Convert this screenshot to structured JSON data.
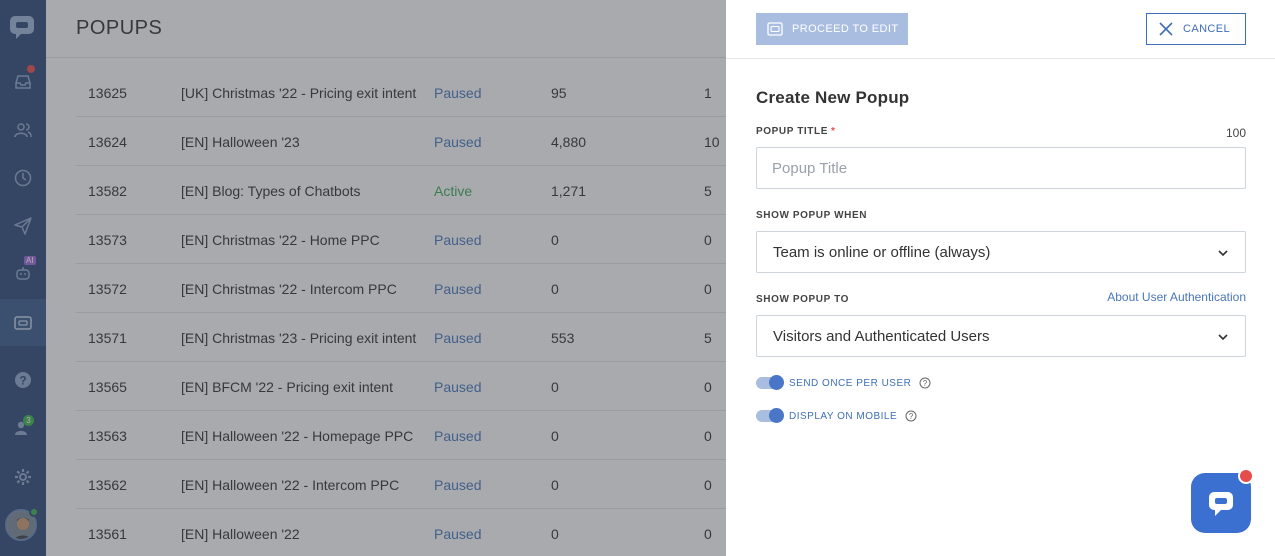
{
  "main": {
    "title": "POPUPS",
    "rows": [
      {
        "id": "13625",
        "name": "[UK] Christmas '22 - Pricing exit intent",
        "status": "Paused",
        "views": "95",
        "x": "1"
      },
      {
        "id": "13624",
        "name": "[EN] Halloween '23",
        "status": "Paused",
        "views": "4,880",
        "x": "10"
      },
      {
        "id": "13582",
        "name": "[EN] Blog: Types of Chatbots",
        "status": "Active",
        "views": "1,271",
        "x": "5"
      },
      {
        "id": "13573",
        "name": "[EN] Christmas '22 - Home PPC",
        "status": "Paused",
        "views": "0",
        "x": "0"
      },
      {
        "id": "13572",
        "name": "[EN] Christmas '22 - Intercom PPC",
        "status": "Paused",
        "views": "0",
        "x": "0"
      },
      {
        "id": "13571",
        "name": "[EN] Christmas '23 - Pricing exit intent",
        "status": "Paused",
        "views": "553",
        "x": "5"
      },
      {
        "id": "13565",
        "name": "[EN] BFCM '22 - Pricing exit intent",
        "status": "Paused",
        "views": "0",
        "x": "0"
      },
      {
        "id": "13563",
        "name": "[EN] Halloween '22 - Homepage PPC",
        "status": "Paused",
        "views": "0",
        "x": "0"
      },
      {
        "id": "13562",
        "name": "[EN] Halloween '22 - Intercom PPC",
        "status": "Paused",
        "views": "0",
        "x": "0"
      },
      {
        "id": "13561",
        "name": "[EN] Halloween '22",
        "status": "Paused",
        "views": "0",
        "x": "0"
      }
    ]
  },
  "sidebar": {
    "ai_badge": "AI",
    "team_badge": "3"
  },
  "panel": {
    "proceed_label": "PROCEED TO EDIT",
    "cancel_label": "CANCEL",
    "form_title": "Create New Popup",
    "popup_title_label": "POPUP TITLE",
    "required_mark": "*",
    "title_counter": "100",
    "title_placeholder": "Popup Title",
    "show_when_label": "SHOW POPUP WHEN",
    "show_when_value": "Team is online or offline (always)",
    "show_to_label": "SHOW POPUP TO",
    "about_link": "About User Authentication",
    "show_to_value": "Visitors and Authenticated Users",
    "toggle_send_once": "SEND ONCE PER USER",
    "toggle_mobile": "DISPLAY ON MOBILE"
  },
  "colors": {
    "sidebar": "#2f4b78",
    "accent": "#3e6fb8",
    "active_status": "#3fa85a",
    "paused_status": "#4a76b8",
    "notification": "#e74c4c"
  }
}
